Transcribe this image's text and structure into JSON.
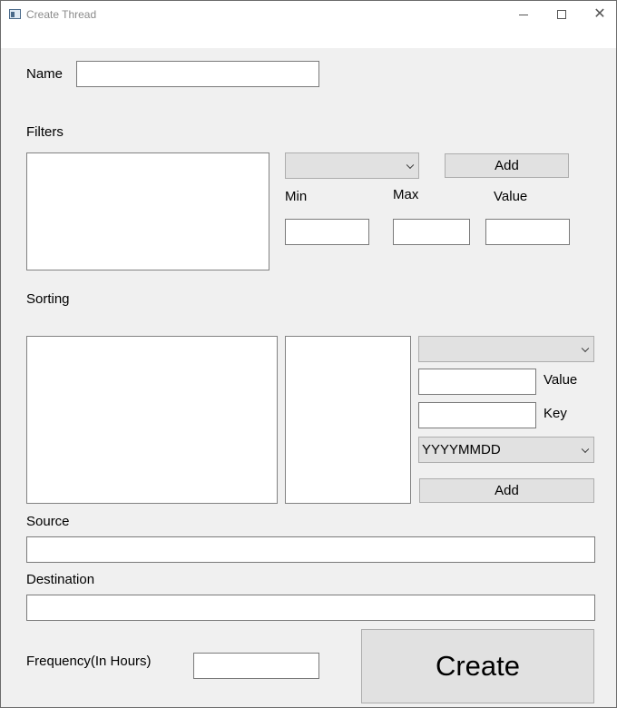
{
  "window": {
    "title": "Create Thread",
    "icon": "window-app-icon"
  },
  "name_label": "Name",
  "name_value": "",
  "filters": {
    "label": "Filters",
    "combo_value": "",
    "add_label": "Add",
    "min_label": "Min",
    "max_label": "Max",
    "value_label": "Value",
    "min_value": "",
    "max_value": "",
    "value_value": ""
  },
  "sorting": {
    "label": "Sorting",
    "combo_value": "",
    "value_label": "Value",
    "key_label": "Key",
    "value_value": "",
    "key_value": "",
    "format_value": "YYYYMMDD",
    "add_label": "Add"
  },
  "source": {
    "label": "Source",
    "value": ""
  },
  "destination": {
    "label": "Destination",
    "value": ""
  },
  "frequency": {
    "label": "Frequency(In Hours)",
    "value": ""
  },
  "create_label": "Create"
}
